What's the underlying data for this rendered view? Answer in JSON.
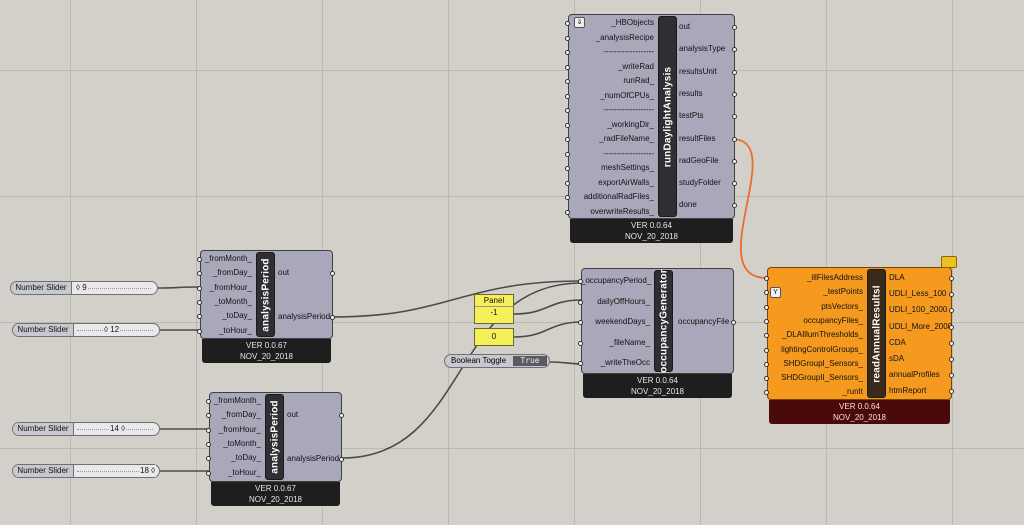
{
  "components": {
    "runDaylight": {
      "title": "runDaylightAnalysis",
      "inputs": [
        "_HBObjects",
        "_analysisRecipe",
        "-------------------",
        "_writeRad",
        "runRad_",
        "_numOfCPUs_",
        "-------------------",
        "_workingDir_",
        "_radFileName_",
        "-------------------",
        "meshSettings_",
        "exportAirWalls_",
        "additionalRadFiles_",
        "overwriteResults_"
      ],
      "outputs": [
        "out",
        "analysisType",
        "resultsUnit",
        "results",
        "testPts",
        "resultFiles",
        "radGeoFile",
        "studyFolder",
        "done"
      ],
      "version": "VER 0.0.64",
      "date": "NOV_20_2018"
    },
    "analysisPeriod1": {
      "title": "analysisPeriod",
      "inputs": [
        "_fromMonth_",
        "_fromDay_",
        "_fromHour_",
        "_toMonth_",
        "_toDay_",
        "_toHour_"
      ],
      "outputs": [
        "out",
        "analysisPeriod"
      ],
      "version": "VER 0.0.67",
      "date": "NOV_20_2018"
    },
    "analysisPeriod2": {
      "title": "analysisPeriod",
      "inputs": [
        "_fromMonth_",
        "_fromDay_",
        "_fromHour_",
        "_toMonth_",
        "_toDay_",
        "_toHour_"
      ],
      "outputs": [
        "out",
        "analysisPeriod"
      ],
      "version": "VER 0.0.67",
      "date": "NOV_20_2018"
    },
    "occupancyGenerator": {
      "title": "occupancyGenerator",
      "inputs": [
        "_occupancyPeriod_",
        "dailyOffHours_",
        "weekendDays_",
        "_fileName_",
        "_writeTheOcc"
      ],
      "outputs": [
        "occupancyFile"
      ],
      "version": "VER 0.0.64",
      "date": "NOV_20_2018"
    },
    "readAnnual": {
      "title": "readAnnualResultsI",
      "inputs": [
        "_illFilesAddress",
        "_testPoints",
        "ptsVectors_",
        "occupancyFiles_",
        "_DLAIllumThresholds_",
        "lightingControlGroups_",
        "SHDGroupI_Sensors_",
        "SHDGroupII_Sensors_",
        "_runIt"
      ],
      "outputs": [
        "DLA",
        "UDLI_Less_100",
        "UDLI_100_2000",
        "UDLI_More_2000",
        "CDA",
        "sDA",
        "annualProfiles",
        "htmReport"
      ],
      "version": "VER 0.0.64",
      "date": "NOV_20_2018"
    }
  },
  "sliders": [
    {
      "label": "Number Slider",
      "value": "9"
    },
    {
      "label": "Number Slider",
      "value": "12"
    },
    {
      "label": "Number Slider",
      "value": "14"
    },
    {
      "label": "Number Slider",
      "value": "18"
    }
  ],
  "panels": [
    {
      "header": "Panel",
      "value": "-1"
    },
    {
      "header": "",
      "value": "0"
    }
  ],
  "toggle": {
    "label": "Boolean Toggle",
    "value": "True"
  },
  "colors": {
    "canvas": "#d2d0c8",
    "component": "#a9a8ba",
    "highlight": "#f59a1e",
    "wire": "#4a4a4a",
    "selected_wire": "#f06a2a"
  }
}
